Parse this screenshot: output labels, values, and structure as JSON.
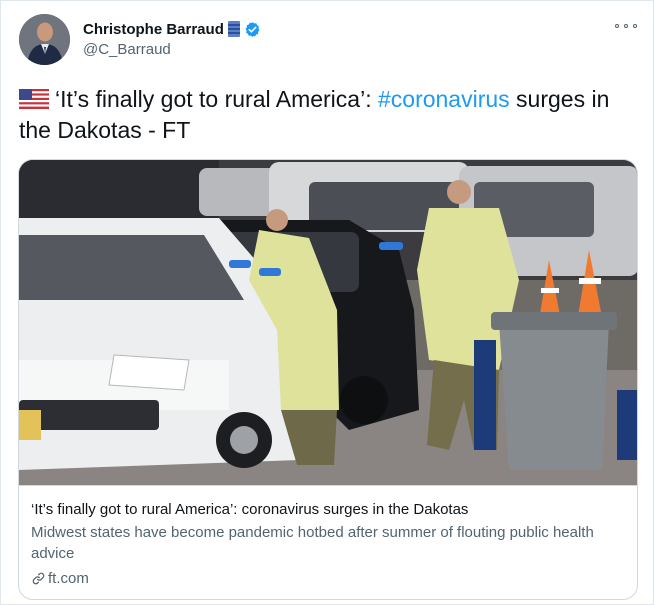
{
  "author": {
    "display_name": "Christophe Barraud",
    "handle": "@C_Barraud",
    "avatar_icon": "profile-photo",
    "badges": [
      "blue-bars-emoji",
      "verified-badge-icon"
    ]
  },
  "menu": {
    "icon": "more-options-icon"
  },
  "tweet": {
    "flag_icon": "us-flag-emoji",
    "text_before": "‘It’s finally got to rural America’: ",
    "hashtag": "#coronavirus",
    "text_after": " surges in the Dakotas - FT"
  },
  "link_card": {
    "image_alt": "Health workers in protective gowns testing drivers in cars at a drive-through site",
    "title": "‘It’s finally got to rural America’: coronavirus surges in the Dakotas",
    "description": "Midwest states have become pandemic hotbed after summer of flouting public health advice",
    "domain": "ft.com",
    "domain_icon": "link-icon"
  },
  "colors": {
    "accent": "#1d9bf0",
    "text_primary": "#0f1419",
    "text_secondary": "#536471",
    "border": "#cfd9de"
  }
}
